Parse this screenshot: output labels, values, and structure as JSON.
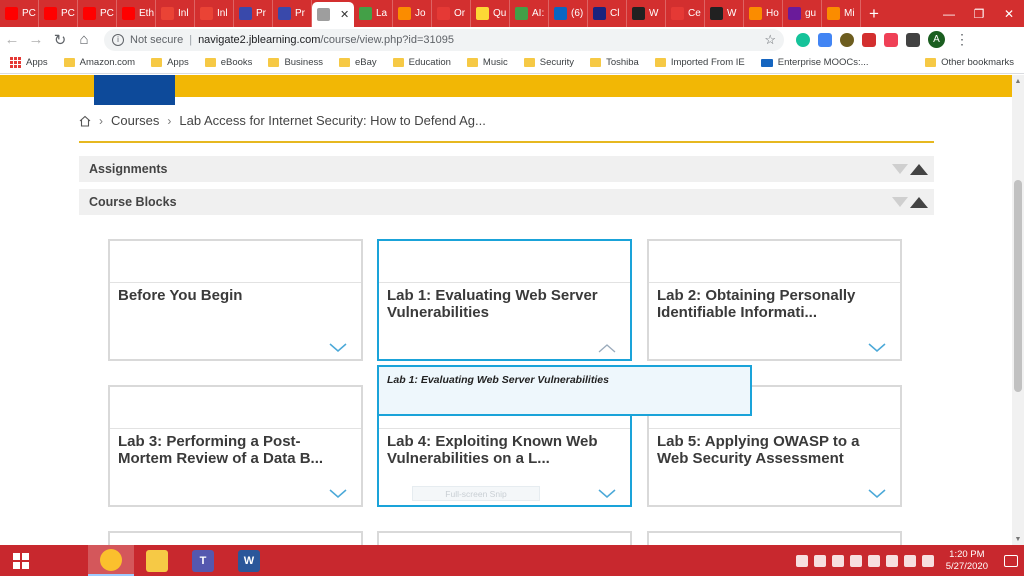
{
  "browser": {
    "tabs": [
      {
        "label": "PC",
        "icon": "youtube-icon",
        "color": "#ff0000"
      },
      {
        "label": "PC",
        "icon": "youtube-icon",
        "color": "#ff0000"
      },
      {
        "label": "PC",
        "icon": "youtube-icon",
        "color": "#ff0000"
      },
      {
        "label": "Eth",
        "icon": "youtube-icon",
        "color": "#ff0000"
      },
      {
        "label": "Inl",
        "icon": "gmail-icon",
        "color": "#ea4335"
      },
      {
        "label": "Inl",
        "icon": "gmail-icon",
        "color": "#ea4335"
      },
      {
        "label": "Pr",
        "icon": "flag-icon",
        "color": "#3949ab"
      },
      {
        "label": "Pr",
        "icon": "flag-icon",
        "color": "#3949ab"
      },
      {
        "label": "",
        "icon": "spinner-icon",
        "color": "#9e9e9e",
        "active": true
      },
      {
        "label": "La",
        "icon": "leaf-icon",
        "color": "#43a047"
      },
      {
        "label": "Jo",
        "icon": "diamond-icon",
        "color": "#fb8c00"
      },
      {
        "label": "Or",
        "icon": "a-icon",
        "color": "#e53935"
      },
      {
        "label": "Qu",
        "icon": "q-icon",
        "color": "#fdd835"
      },
      {
        "label": "AI:",
        "icon": "ab-icon",
        "color": "#43a047"
      },
      {
        "label": "(6)",
        "icon": "linkedin-icon",
        "color": "#0a66c2"
      },
      {
        "label": "Cl",
        "icon": "star-icon",
        "color": "#1a237e"
      },
      {
        "label": "W",
        "icon": "n-icon",
        "color": "#212121"
      },
      {
        "label": "Ce",
        "icon": "error-icon",
        "color": "#e53935"
      },
      {
        "label": "W",
        "icon": "wb-icon",
        "color": "#212121"
      },
      {
        "label": "Ho",
        "icon": "h-icon",
        "color": "#fb8c00"
      },
      {
        "label": "gu",
        "icon": "y-icon",
        "color": "#6a1b9a"
      },
      {
        "label": "Mi",
        "icon": "m-icon",
        "color": "#fb8c00"
      }
    ],
    "new_tab_symbol": "+",
    "window_controls": [
      "—",
      "❐",
      "✕"
    ],
    "url": {
      "security": "Not secure",
      "host": "navigate2.jblearning.com",
      "path": "/course/view.php?id=31095"
    },
    "profile_initial": "A",
    "bookmarks": [
      {
        "label": "Apps",
        "icon": "apps-grid-icon"
      },
      {
        "label": "Amazon.com",
        "icon": "folder-icon"
      },
      {
        "label": "Apps",
        "icon": "folder-icon"
      },
      {
        "label": "eBooks",
        "icon": "folder-icon"
      },
      {
        "label": "Business",
        "icon": "folder-icon"
      },
      {
        "label": "eBay",
        "icon": "folder-icon"
      },
      {
        "label": "Education",
        "icon": "folder-icon"
      },
      {
        "label": "Music",
        "icon": "folder-icon"
      },
      {
        "label": "Security",
        "icon": "folder-icon"
      },
      {
        "label": "Toshiba",
        "icon": "folder-icon"
      },
      {
        "label": "Imported From IE",
        "icon": "folder-icon"
      },
      {
        "label": "Enterprise MOOCs:...",
        "icon": "link-icon"
      }
    ],
    "other_bookmarks": "Other bookmarks"
  },
  "page": {
    "breadcrumb": [
      "Courses",
      "Lab Access for Internet Security: How to Defend Ag..."
    ],
    "sections": [
      "Assignments",
      "Course Blocks"
    ],
    "cards": [
      {
        "title": "Before You Begin",
        "highlight": false
      },
      {
        "title": "Lab 1: Evaluating Web Server Vulnerabilities",
        "highlight": true
      },
      {
        "title": "Lab 2: Obtaining Personally Identifiable Informati...",
        "highlight": false
      },
      {
        "title": "Lab 3: Performing a Post-Mortem Review of a Data B...",
        "highlight": false
      },
      {
        "title": "Lab 4: Exploiting Known Web Vulnerabilities on a L...",
        "highlight": true
      },
      {
        "title": "Lab 5: Applying OWASP to a Web Security Assessment",
        "highlight": false
      }
    ],
    "tooltip": "Lab 1: Evaluating Web Server Vulnerabilities",
    "snip_label": "Full-screen Snip"
  },
  "taskbar": {
    "apps": [
      {
        "name": "snipping-tool",
        "label": "",
        "color": "#c8282e"
      },
      {
        "name": "chrome",
        "label": "",
        "color": "#fbc02d",
        "active": true
      },
      {
        "name": "file-explorer",
        "label": "",
        "color": "#f6c945"
      },
      {
        "name": "teams",
        "label": "T",
        "color": "#5558af"
      },
      {
        "name": "word",
        "label": "W",
        "color": "#2b579a"
      }
    ],
    "time": "1:20 PM",
    "date": "5/27/2020"
  }
}
